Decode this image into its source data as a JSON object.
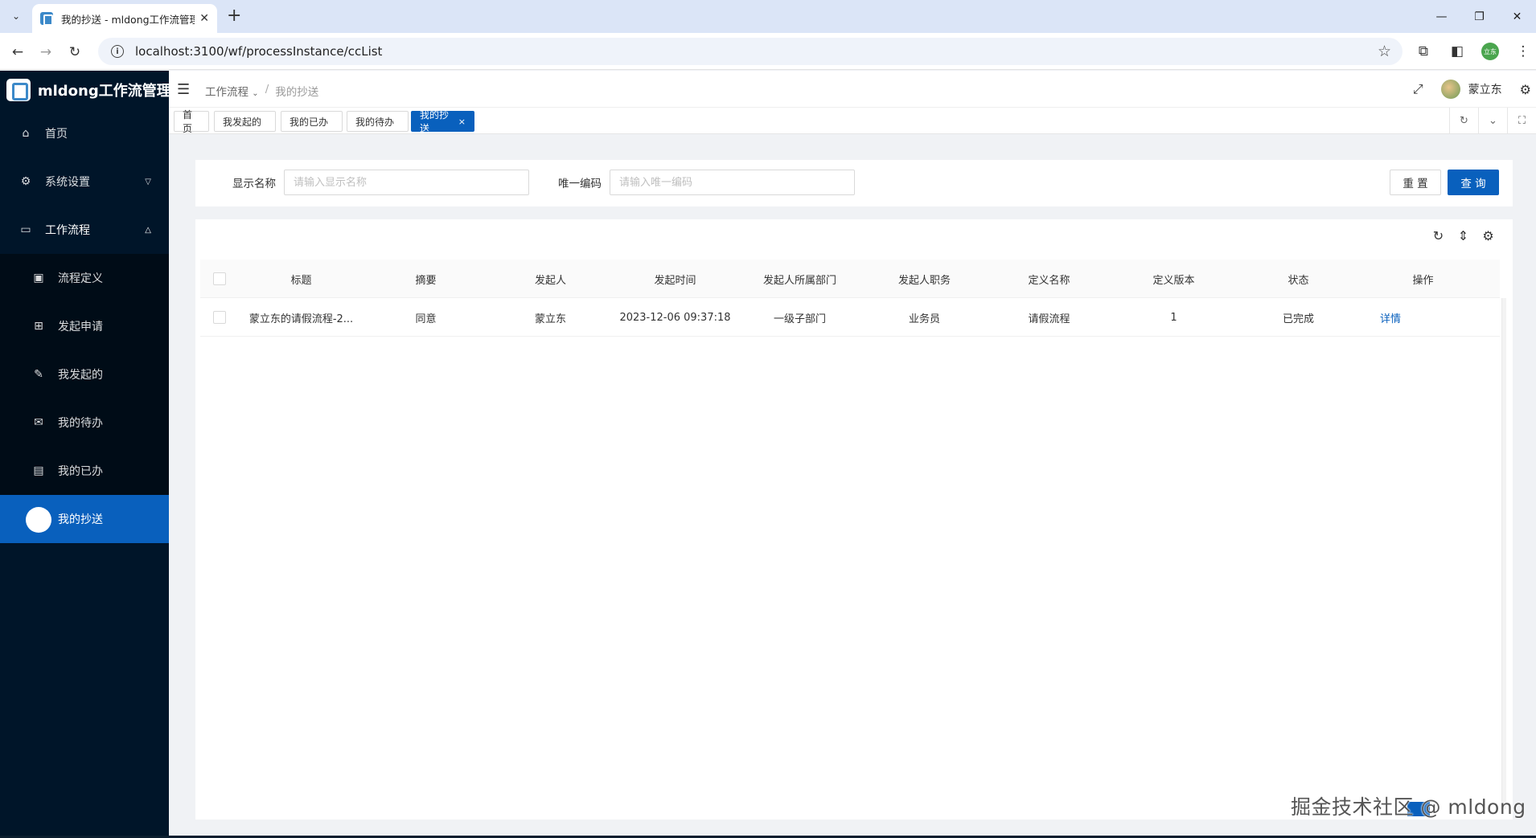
{
  "browser": {
    "tab_title": "我的抄送 - mldong工作流管理",
    "url": "localhost:3100/wf/processInstance/ccList",
    "profile_label": "立东"
  },
  "sidebar": {
    "app_name": "mldong工作流管理...",
    "items": [
      {
        "label": "首页",
        "icon": "home-icon"
      },
      {
        "label": "系统设置",
        "icon": "gear-icon"
      },
      {
        "label": "工作流程",
        "icon": "laptop-icon"
      }
    ],
    "workflow_items": [
      {
        "label": "流程定义",
        "icon": "picture-icon"
      },
      {
        "label": "发起申请",
        "icon": "appstore-icon"
      },
      {
        "label": "我发起的",
        "icon": "edit-icon"
      },
      {
        "label": "我的待办",
        "icon": "mail-icon"
      },
      {
        "label": "我的已办",
        "icon": "read-icon"
      },
      {
        "label": "我的抄送",
        "icon": "selected-circle"
      }
    ]
  },
  "header": {
    "breadcrumb_parent": "工作流程",
    "breadcrumb_sep": "/",
    "breadcrumb_current": "我的抄送",
    "username": "蒙立东"
  },
  "tabs": [
    "首页",
    "我发起的",
    "我的已办",
    "我的待办",
    "我的抄送"
  ],
  "tab_close": "×",
  "search": {
    "name_label": "显示名称",
    "name_placeholder": "请输入显示名称",
    "code_label": "唯一编码",
    "code_placeholder": "请输入唯一编码",
    "reset_label": "重 置",
    "query_label": "查 询"
  },
  "table": {
    "columns": [
      "标题",
      "摘要",
      "发起人",
      "发起时间",
      "发起人所属部门",
      "发起人职务",
      "定义名称",
      "定义版本",
      "状态",
      "操作"
    ],
    "rows": [
      {
        "title": "蒙立东的请假流程-2...",
        "summary": "同意",
        "initiator": "蒙立东",
        "time": "2023-12-06 09:37:18",
        "dept": "一级子部门",
        "post": "业务员",
        "def_name": "请假流程",
        "version": "1",
        "status": "已完成",
        "action": "详情"
      }
    ]
  },
  "watermark": "掘金技术社区 @ mldong",
  "colors": {
    "primary": "#0960bd",
    "sidebar_bg": "#001529",
    "submenu_bg": "#000c17"
  }
}
